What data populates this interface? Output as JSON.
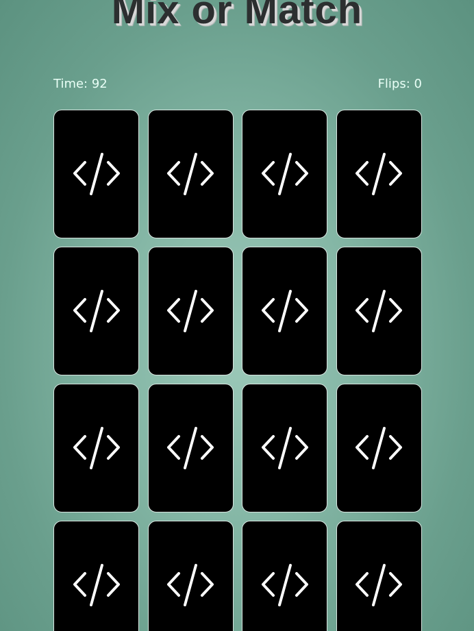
{
  "title": "Mix or Match",
  "stats": {
    "time_label": "Time:",
    "time_value": "92",
    "flips_label": "Flips:",
    "flips_value": "0"
  },
  "cards": [
    {
      "face": "code-icon"
    },
    {
      "face": "code-icon"
    },
    {
      "face": "code-icon"
    },
    {
      "face": "code-icon"
    },
    {
      "face": "code-icon"
    },
    {
      "face": "code-icon"
    },
    {
      "face": "code-icon"
    },
    {
      "face": "code-icon"
    },
    {
      "face": "code-icon"
    },
    {
      "face": "code-icon"
    },
    {
      "face": "code-icon"
    },
    {
      "face": "code-icon"
    },
    {
      "face": "code-icon"
    },
    {
      "face": "code-icon"
    },
    {
      "face": "code-icon"
    },
    {
      "face": "code-icon"
    }
  ],
  "colors": {
    "card_back": "#000000",
    "card_border": "#d9e6e1",
    "icon": "#ffffff",
    "stats_text": "#e9fff6",
    "title_text": "#2c2f30"
  }
}
